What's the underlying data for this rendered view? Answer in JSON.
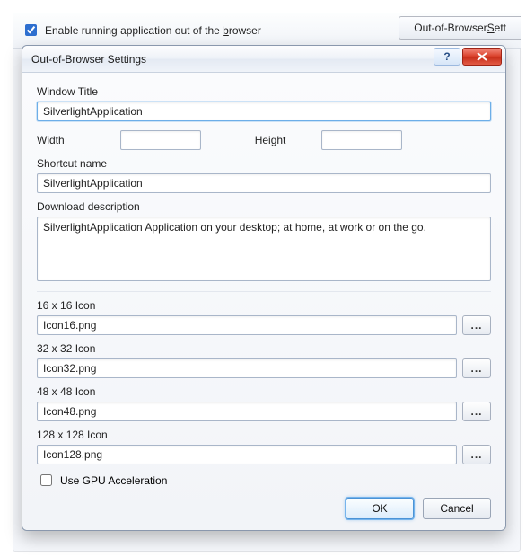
{
  "parent": {
    "checkbox_checked": true,
    "checkbox_label_pre": "Enable running application out of the ",
    "checkbox_label_key": "b",
    "checkbox_label_post": "rowser",
    "button_pre": "Out-of-Browser ",
    "button_key": "S",
    "button_post": "ett"
  },
  "dialog": {
    "title": "Out-of-Browser Settings",
    "help_glyph": "?",
    "labels": {
      "window_title": "Window Title",
      "width": "Width",
      "height": "Height",
      "shortcut_name": "Shortcut name",
      "download_desc": "Download description",
      "icon16": "16 x 16 Icon",
      "icon32": "32 x 32 Icon",
      "icon48": "48 x 48 Icon",
      "icon128": "128 x 128 Icon",
      "gpu": "Use GPU Acceleration"
    },
    "values": {
      "window_title": "SilverlightApplication",
      "width": "",
      "height": "",
      "shortcut_name": "SilverlightApplication",
      "download_desc": "SilverlightApplication Application on your desktop; at home, at work or on the go.",
      "icon16": "Icon16.png",
      "icon32": "Icon32.png",
      "icon48": "Icon48.png",
      "icon128": "Icon128.png",
      "gpu_checked": false
    },
    "browse_glyph": "...",
    "buttons": {
      "ok": "OK",
      "cancel": "Cancel"
    }
  }
}
